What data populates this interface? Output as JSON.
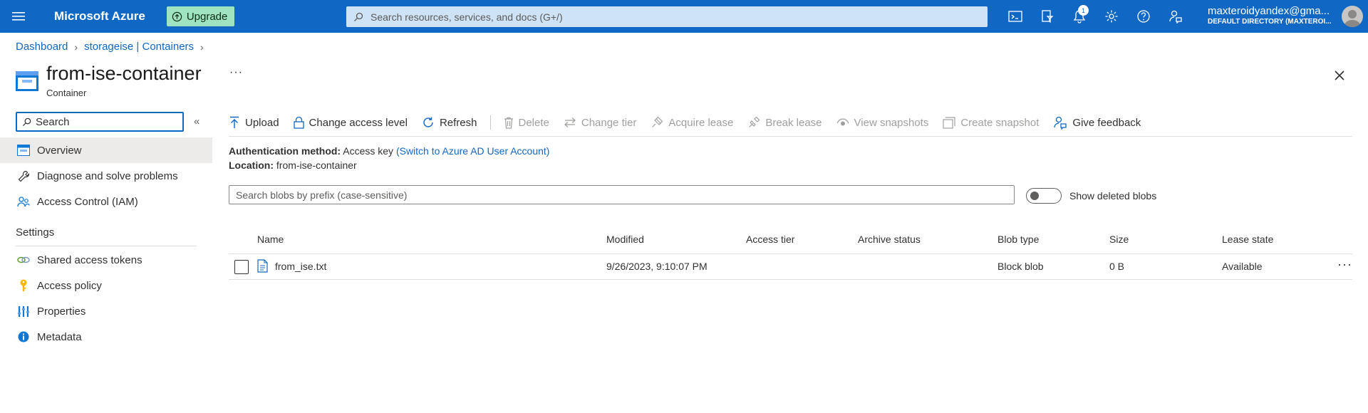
{
  "topbar": {
    "brand": "Microsoft Azure",
    "upgrade_label": "Upgrade",
    "search_placeholder": "Search resources, services, and docs (G+/)",
    "notification_count": "1",
    "account_name": "maxteroidyandex@gma...",
    "account_directory": "DEFAULT DIRECTORY (MAXTEROI...",
    "icons": [
      "cloud-shell-icon",
      "directory-filter-icon",
      "notifications-icon",
      "settings-icon",
      "help-icon",
      "feedback-icon"
    ]
  },
  "breadcrumb": {
    "items": [
      "Dashboard",
      "storageise | Containers"
    ]
  },
  "header": {
    "title": "from-ise-container",
    "subtitle": "Container",
    "more": "···"
  },
  "nav": {
    "search_placeholder": "Search",
    "collapse": "«",
    "items": [
      {
        "label": "Overview",
        "icon": "overview-icon"
      },
      {
        "label": "Diagnose and solve problems",
        "icon": "wrench-icon"
      },
      {
        "label": "Access Control (IAM)",
        "icon": "people-icon"
      }
    ],
    "section_settings": "Settings",
    "settings_items": [
      {
        "label": "Shared access tokens",
        "icon": "link-icon"
      },
      {
        "label": "Access policy",
        "icon": "key-icon"
      },
      {
        "label": "Properties",
        "icon": "properties-icon"
      },
      {
        "label": "Metadata",
        "icon": "info-icon"
      }
    ]
  },
  "toolbar": {
    "upload": "Upload",
    "change_access_level": "Change access level",
    "refresh": "Refresh",
    "delete": "Delete",
    "change_tier": "Change tier",
    "acquire_lease": "Acquire lease",
    "break_lease": "Break lease",
    "view_snapshots": "View snapshots",
    "create_snapshot": "Create snapshot",
    "give_feedback": "Give feedback"
  },
  "info": {
    "auth_label": "Authentication method:",
    "auth_value": "Access key",
    "auth_link": "(Switch to Azure AD User Account)",
    "location_label": "Location:",
    "location_value": "from-ise-container"
  },
  "blob_search": {
    "placeholder": "Search blobs by prefix (case-sensitive)",
    "show_deleted_label": "Show deleted blobs",
    "show_deleted": false
  },
  "table": {
    "columns": [
      "Name",
      "Modified",
      "Access tier",
      "Archive status",
      "Blob type",
      "Size",
      "Lease state"
    ],
    "rows": [
      {
        "name": "from_ise.txt",
        "modified": "9/26/2023, 9:10:07 PM",
        "access_tier": "",
        "archive_status": "",
        "blob_type": "Block blob",
        "size": "0 B",
        "lease_state": "Available",
        "more": "···"
      }
    ]
  },
  "colors": {
    "topbar": "#1068c4",
    "accent": "#1068c4",
    "upgrade_bg": "#9fe3c0",
    "nav_active": "#edebe9"
  }
}
